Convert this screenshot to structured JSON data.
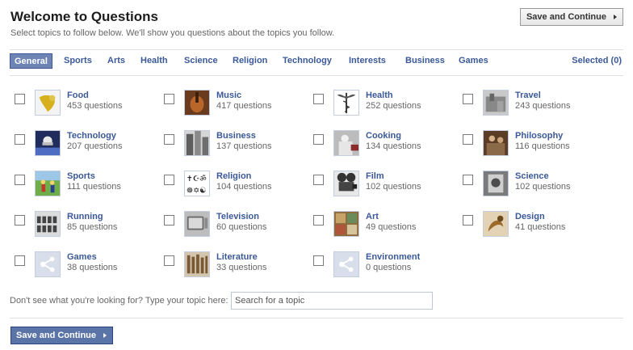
{
  "header": {
    "title": "Welcome to Questions",
    "subtitle": "Select topics to follow below. We'll show you questions about the topics you follow.",
    "save_label": "Save and Continue"
  },
  "tabs": {
    "items": [
      {
        "label": "General",
        "active": true
      },
      {
        "label": "Sports"
      },
      {
        "label": "Arts"
      },
      {
        "label": "Health"
      },
      {
        "label": "Science"
      },
      {
        "label": "Religion"
      },
      {
        "label": "Technology"
      },
      {
        "label": "Interests"
      },
      {
        "label": "Business"
      },
      {
        "label": "Games"
      }
    ],
    "selected_label": "Selected (0)"
  },
  "topics": [
    {
      "name": "Food",
      "count": "453 questions",
      "icon": "food-photo"
    },
    {
      "name": "Music",
      "count": "417 questions",
      "icon": "music-photo"
    },
    {
      "name": "Health",
      "count": "252 questions",
      "icon": "health-caduceus"
    },
    {
      "name": "Travel",
      "count": "243 questions",
      "icon": "travel-photo"
    },
    {
      "name": "Technology",
      "count": "207 questions",
      "icon": "technology-photo"
    },
    {
      "name": "Business",
      "count": "137 questions",
      "icon": "business-photo"
    },
    {
      "name": "Cooking",
      "count": "134 questions",
      "icon": "cooking-photo"
    },
    {
      "name": "Philosophy",
      "count": "116 questions",
      "icon": "philosophy-photo"
    },
    {
      "name": "Sports",
      "count": "111 questions",
      "icon": "sports-photo"
    },
    {
      "name": "Religion",
      "count": "104 questions",
      "icon": "religion-symbols"
    },
    {
      "name": "Film",
      "count": "102 questions",
      "icon": "film-camera"
    },
    {
      "name": "Science",
      "count": "102 questions",
      "icon": "science-photo"
    },
    {
      "name": "Running",
      "count": "85 questions",
      "icon": "running-photo"
    },
    {
      "name": "Television",
      "count": "60 questions",
      "icon": "television-photo"
    },
    {
      "name": "Art",
      "count": "49 questions",
      "icon": "art-photo"
    },
    {
      "name": "Design",
      "count": "41 questions",
      "icon": "design-photo"
    },
    {
      "name": "Games",
      "count": "38 questions",
      "icon": "default-topic"
    },
    {
      "name": "Literature",
      "count": "33 questions",
      "icon": "literature-photo"
    },
    {
      "name": "Environment",
      "count": "0 questions",
      "icon": "default-topic"
    }
  ],
  "search": {
    "label": "Don't see what you're looking for? Type your topic here:",
    "placeholder": "Search for a topic",
    "value": ""
  },
  "footer": {
    "save_label": "Save and Continue"
  },
  "colors": {
    "link": "#3b5998",
    "active_tab": "#6d84b4",
    "primary_button": "#5b74a8"
  }
}
